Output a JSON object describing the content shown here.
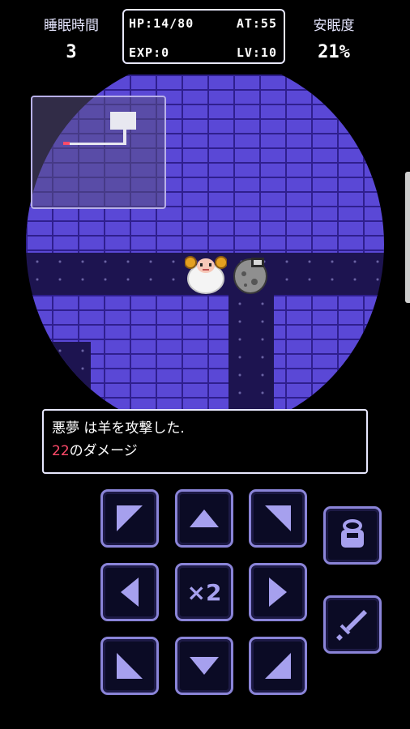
{
  "stats": {
    "sleep_time_label": "睡眠時間",
    "sleep_time_value": "3",
    "hp": "HP:14/80",
    "at": "AT:55",
    "exp": "EXP:0",
    "lv": "LV:10",
    "comfort_label": "安眠度",
    "comfort_value": "21%"
  },
  "message": {
    "line1": "悪夢 は羊を攻撃した.",
    "damage_number": "22",
    "damage_suffix": "のダメージ"
  },
  "controls": {
    "speed_label": "×2",
    "icons": [
      "arrow-up-left-icon",
      "arrow-up-icon",
      "arrow-up-right-icon",
      "arrow-left-icon",
      "arrow-right-icon",
      "arrow-down-left-icon",
      "arrow-down-icon",
      "arrow-down-right-icon",
      "item-bag-icon",
      "sword-icon"
    ]
  },
  "colors": {
    "brick": "#5a48d6",
    "mortar": "#2f1f8e",
    "floor": "#1d1450",
    "button_border": "#8a84d8",
    "damage": "#ff4a6a"
  }
}
